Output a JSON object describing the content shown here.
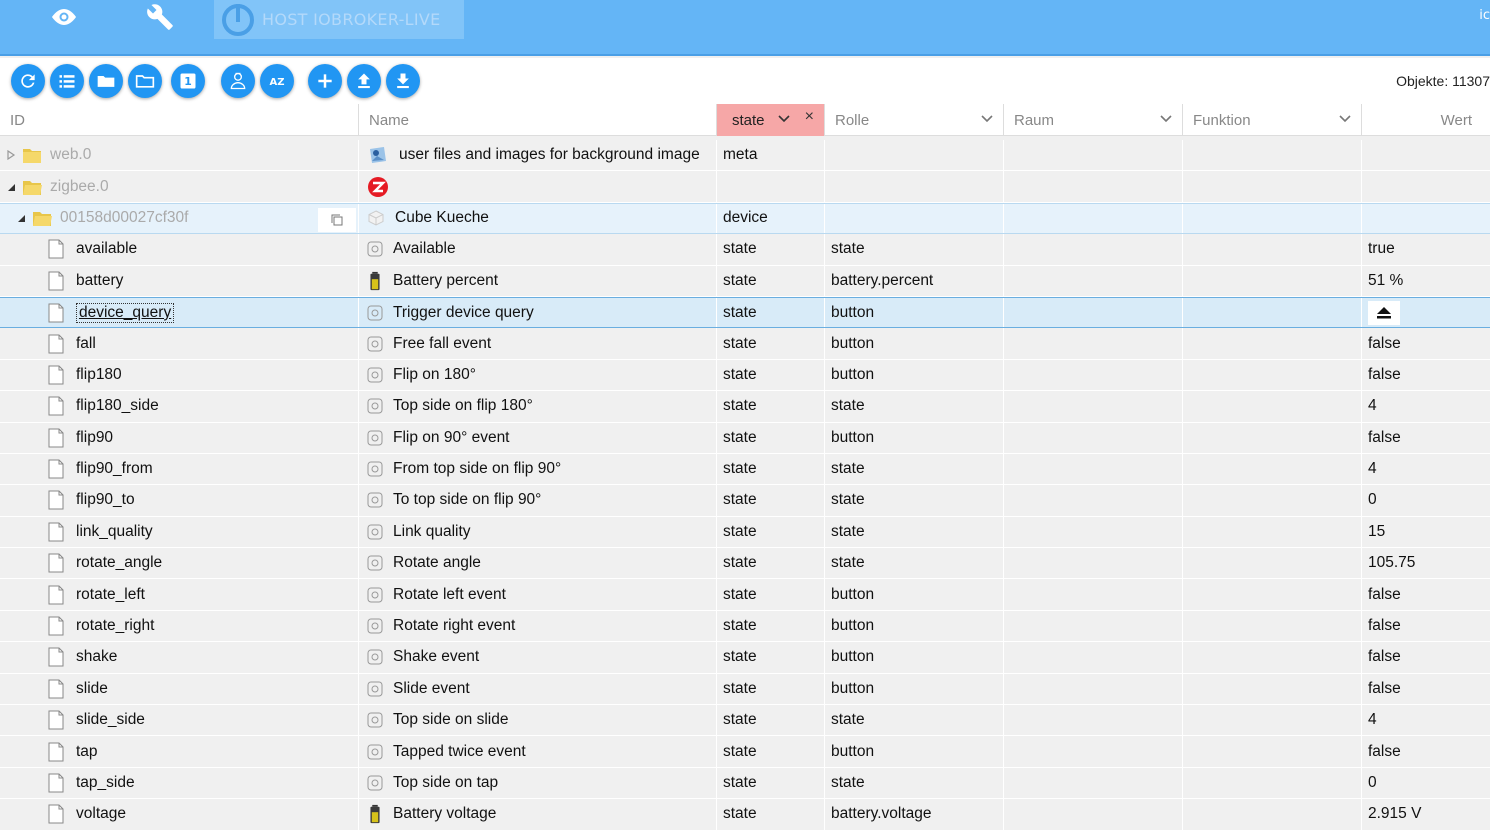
{
  "topbar": {
    "host_label": "HOST IOBROKER-LIVE",
    "right_text": "ic",
    "accent": "#64b5f6"
  },
  "toolbar": {
    "buttons": [
      "refresh-icon",
      "list-icon",
      "folder-open-icon",
      "folder-closed-icon",
      "one-icon",
      "admin-icon",
      "sort-az-icon",
      "add-icon",
      "upload-icon",
      "download-icon"
    ],
    "az_label": "AZ",
    "one_label": "1",
    "object_count": "Objekte: 11307"
  },
  "columns": {
    "id": "ID",
    "name": "Name",
    "type_filter": "state",
    "role": "Rolle",
    "room": "Raum",
    "function": "Funktion",
    "value": "Wert"
  },
  "rows": [
    {
      "id": "web.0",
      "name": "user files and images for background image",
      "type": "meta",
      "role": "",
      "value": "",
      "kind": "folder",
      "level": 0,
      "expanded": false
    },
    {
      "id": "zigbee.0",
      "name": "",
      "type": "",
      "role": "",
      "value": "",
      "kind": "folder",
      "level": 0,
      "expanded": true
    },
    {
      "id": "00158d00027cf30f",
      "name": "Cube Kueche",
      "type": "device",
      "role": "",
      "value": "",
      "kind": "folder",
      "level": 1,
      "expanded": true
    },
    {
      "id": "available",
      "name": "Available",
      "type": "state",
      "role": "state",
      "value": "true",
      "kind": "state"
    },
    {
      "id": "battery",
      "name": "Battery percent",
      "type": "state",
      "role": "battery.percent",
      "value": "51 %",
      "kind": "battery"
    },
    {
      "id": "device_query",
      "name": "Trigger device query",
      "type": "state",
      "role": "button",
      "value": "",
      "kind": "state",
      "selected": true
    },
    {
      "id": "fall",
      "name": "Free fall event",
      "type": "state",
      "role": "button",
      "value": "false",
      "kind": "state"
    },
    {
      "id": "flip180",
      "name": "Flip on 180°",
      "type": "state",
      "role": "button",
      "value": "false",
      "kind": "state"
    },
    {
      "id": "flip180_side",
      "name": "Top side on flip 180°",
      "type": "state",
      "role": "state",
      "value": "4",
      "kind": "state"
    },
    {
      "id": "flip90",
      "name": "Flip on 90° event",
      "type": "state",
      "role": "button",
      "value": "false",
      "kind": "state"
    },
    {
      "id": "flip90_from",
      "name": "From top side on flip 90°",
      "type": "state",
      "role": "state",
      "value": "4",
      "kind": "state"
    },
    {
      "id": "flip90_to",
      "name": "To top side on flip 90°",
      "type": "state",
      "role": "state",
      "value": "0",
      "kind": "state"
    },
    {
      "id": "link_quality",
      "name": "Link quality",
      "type": "state",
      "role": "state",
      "value": "15",
      "kind": "state"
    },
    {
      "id": "rotate_angle",
      "name": "Rotate angle",
      "type": "state",
      "role": "state",
      "value": "105.75",
      "kind": "state"
    },
    {
      "id": "rotate_left",
      "name": "Rotate left event",
      "type": "state",
      "role": "button",
      "value": "false",
      "kind": "state"
    },
    {
      "id": "rotate_right",
      "name": "Rotate right event",
      "type": "state",
      "role": "button",
      "value": "false",
      "kind": "state"
    },
    {
      "id": "shake",
      "name": "Shake event",
      "type": "state",
      "role": "button",
      "value": "false",
      "kind": "state"
    },
    {
      "id": "slide",
      "name": "Slide event",
      "type": "state",
      "role": "button",
      "value": "false",
      "kind": "state"
    },
    {
      "id": "slide_side",
      "name": "Top side on slide",
      "type": "state",
      "role": "state",
      "value": "4",
      "kind": "state"
    },
    {
      "id": "tap",
      "name": "Tapped twice event",
      "type": "state",
      "role": "button",
      "value": "false",
      "kind": "state"
    },
    {
      "id": "tap_side",
      "name": "Top side on tap",
      "type": "state",
      "role": "state",
      "value": "0",
      "kind": "state"
    },
    {
      "id": "voltage",
      "name": "Battery voltage",
      "type": "state",
      "role": "battery.voltage",
      "value": "2.915 V",
      "kind": "battery"
    }
  ]
}
